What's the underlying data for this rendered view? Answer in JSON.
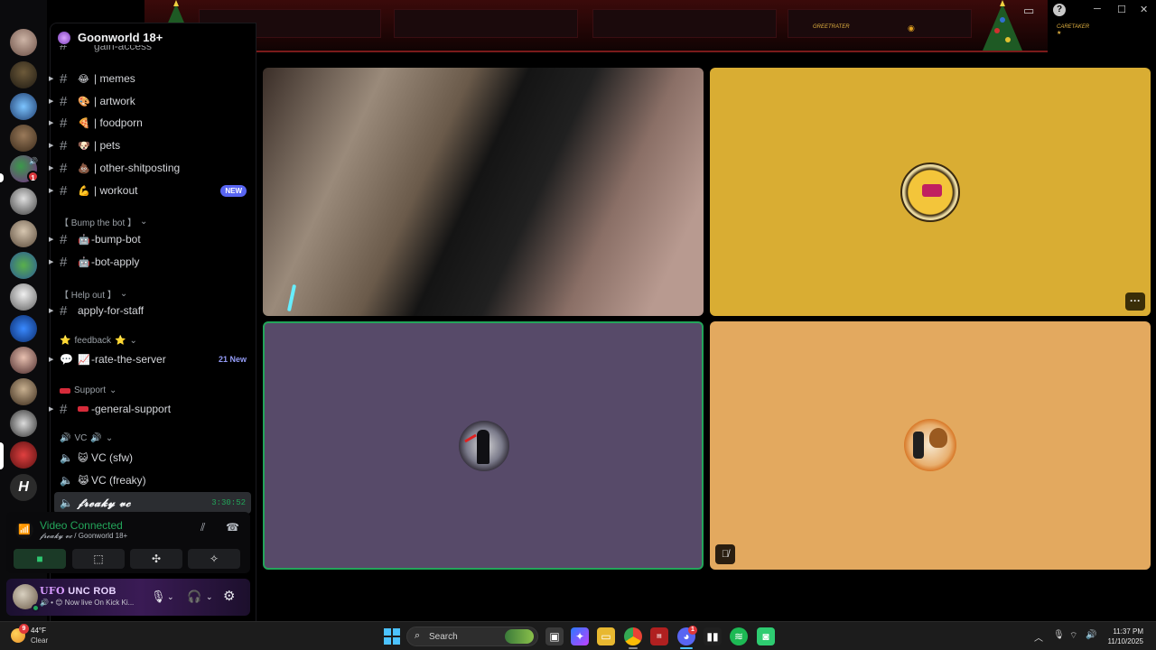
{
  "server": {
    "name": "Goonworld 18+",
    "partial_channel": "gain-access"
  },
  "channels": [
    {
      "emoji": "😂",
      "label": "| memes"
    },
    {
      "emoji": "🎨",
      "label": "| artwork"
    },
    {
      "emoji": "🍕",
      "label": "| foodporn"
    },
    {
      "emoji": "🐶",
      "label": "| pets"
    },
    {
      "emoji": "💩",
      "label": "| other-shitposting"
    },
    {
      "emoji": "💪",
      "label": "| workout",
      "badge": "NEW"
    }
  ],
  "categories": {
    "bump": "【 Bump the bot 】",
    "help": "【 Help out 】",
    "feedback": "feedback",
    "support": "Support",
    "vc": "VC"
  },
  "bump_channels": [
    {
      "emoji": "🤖",
      "label": "-bump-bot"
    },
    {
      "emoji": "🤖",
      "label": "-bot-apply"
    }
  ],
  "help_channels": [
    {
      "label": "apply-for-staff"
    }
  ],
  "feedback_channels": [
    {
      "emoji": "📈",
      "label": "-rate-the-server",
      "badge": "21 New"
    }
  ],
  "support_channels": [
    {
      "label": "-general-support"
    }
  ],
  "voice_channels": [
    {
      "emoji": "😺",
      "label": "VC (sfw)"
    },
    {
      "emoji": "😹",
      "label": "VC (freaky)"
    },
    {
      "label": "𝓯𝓻𝓮𝓪𝓴𝔂 𝓿𝓬",
      "timer": "3:30:52",
      "active": true
    }
  ],
  "voice_panel": {
    "status": "Video Connected",
    "channel": "𝓯𝓻𝓮𝓪𝓴𝔂 𝓿𝓬",
    "server": "Goonworld 18+"
  },
  "user": {
    "tag": "UFO",
    "name": "UNC ROB",
    "status": "Now live On Kick Ki..."
  },
  "rail": {
    "badge": "1"
  },
  "topbar": {
    "tag_a": "GREETRATER",
    "tag_b": "CARETAKER ★"
  },
  "taskbar": {
    "weather_temp": "44°F",
    "weather_desc": "Clear",
    "weather_badge": "9",
    "search_label": "Search",
    "time": "11:37 PM",
    "date": "11/10/2025",
    "discord_badge": "1"
  },
  "colors": {
    "connected": "#23a55a",
    "tile_gold": "#d9ad33",
    "tile_purple": "#574a69",
    "tile_orange": "#e3a95f",
    "new_pill": "#5865f2"
  }
}
